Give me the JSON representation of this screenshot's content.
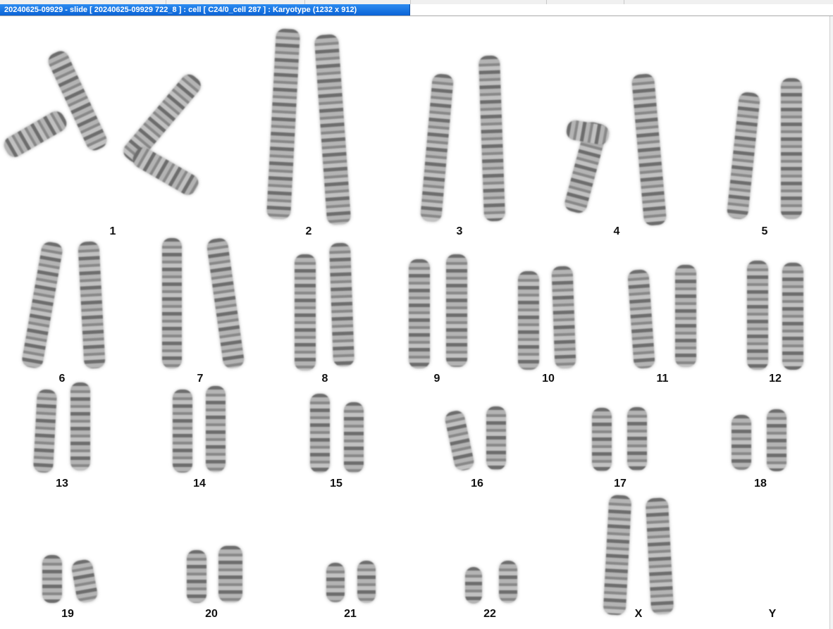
{
  "window": {
    "title": "20240625-09929 - slide [ 20240625-09929 722_8 ] : cell [ C24/0_cell 287 ] : Karyotype  (1232 x 912)"
  },
  "karyotype": {
    "labels": {
      "c1": "1",
      "c2": "2",
      "c3": "3",
      "c4": "4",
      "c5": "5",
      "c6": "6",
      "c7": "7",
      "c8": "8",
      "c9": "9",
      "c10": "10",
      "c11": "11",
      "c12": "12",
      "c13": "13",
      "c14": "14",
      "c15": "15",
      "c16": "16",
      "c17": "17",
      "c18": "18",
      "c19": "19",
      "c20": "20",
      "c21": "21",
      "c22": "22",
      "cx": "X",
      "cy": "Y"
    }
  }
}
